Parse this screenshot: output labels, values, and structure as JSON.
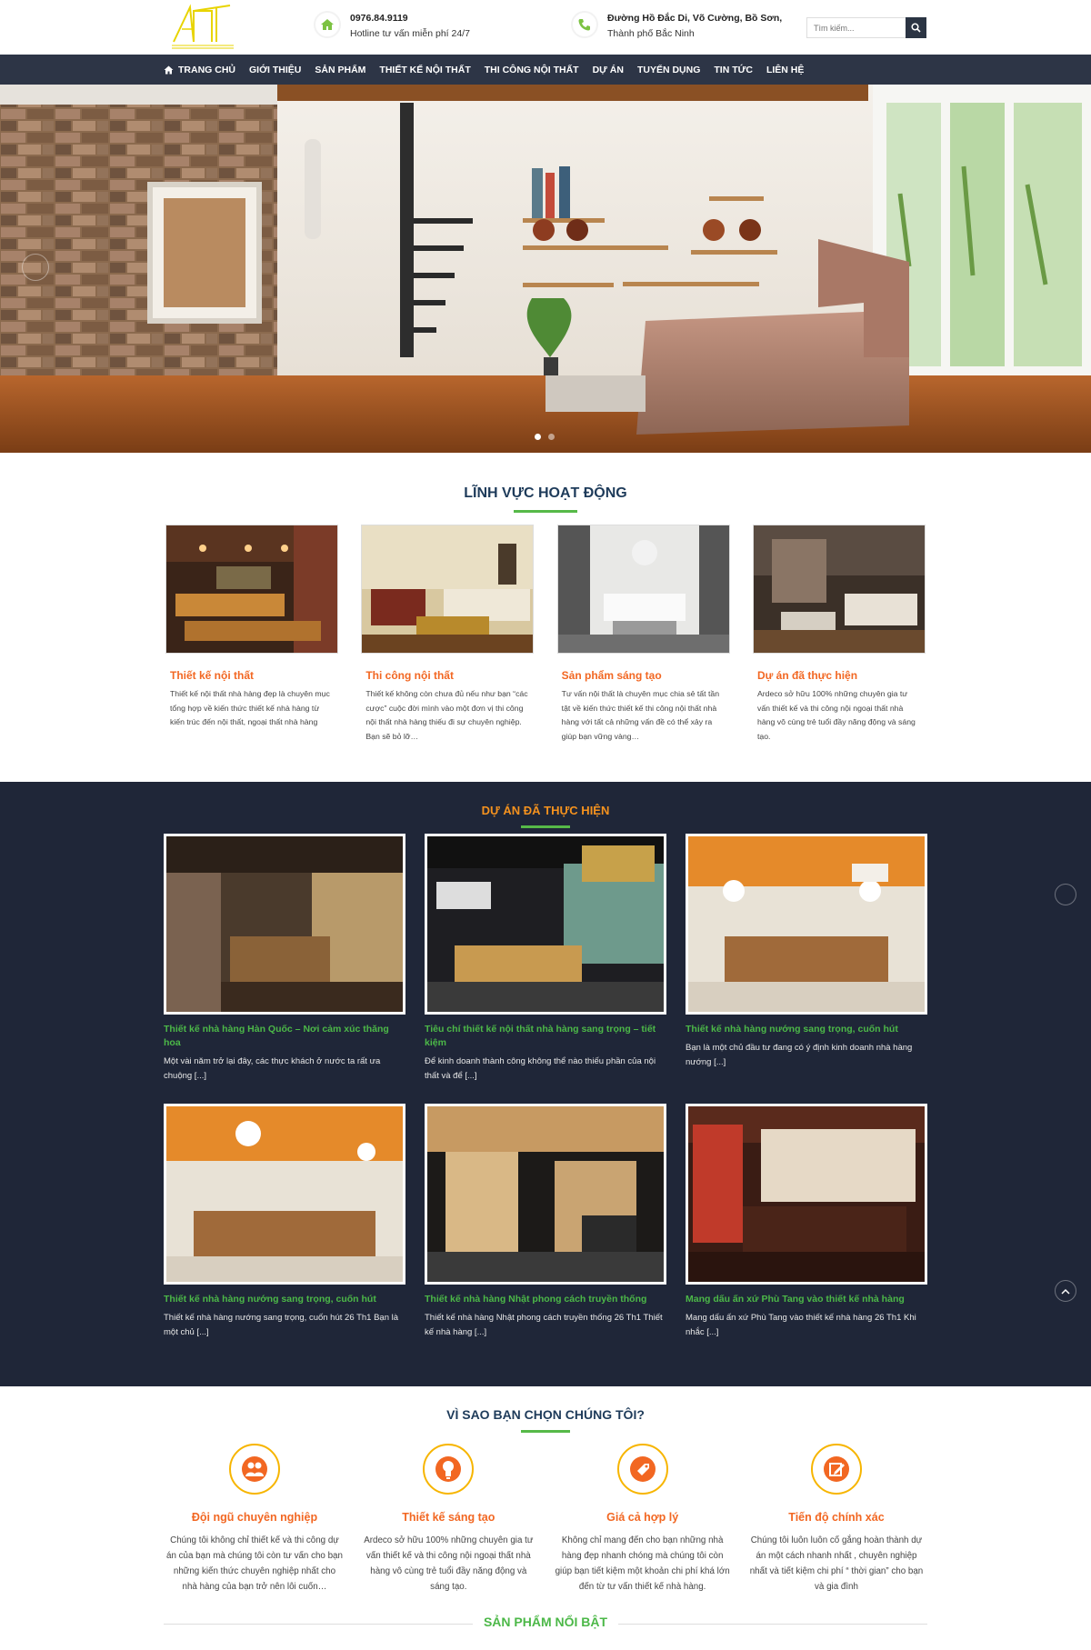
{
  "header": {
    "logo_alt": "AT",
    "phone": "0976.84.9119",
    "hotline": "Hotline tư vấn miễn phí 24/7",
    "address_line1": "Đường Hồ Đắc Di, Võ Cường, Bồ Sơn,",
    "address_line2": "Thành phố Bắc Ninh",
    "search_placeholder": "Tìm kiếm...",
    "phone_icon_color": "#7cc242",
    "address_icon_color": "#7cc242"
  },
  "nav": {
    "items": [
      "TRANG CHỦ",
      "GIỚI THIỆU",
      "SẢN PHẨM",
      "THIẾT KẾ NỘI THẤT",
      "THI CÔNG NỘI THẤT",
      "DỰ ÁN",
      "TUYỂN DỤNG",
      "TIN TỨC",
      "LIÊN HỆ"
    ]
  },
  "hero": {
    "slides": 2,
    "active_slide": 1
  },
  "fields": {
    "title": "LĨNH VỰC HOẠT ĐỘNG",
    "items": [
      {
        "title": "Thiết kế nội thất",
        "text": "Thiết kế nội thất nhà hàng đẹp là chuyên mục tổng hợp về kiến thức thiết kế nhà hàng từ kiến trúc đến nội thất, ngoại thất nhà hàng"
      },
      {
        "title": "Thi công nội thất",
        "text": "Thiết kế không còn chưa đủ nếu như bạn “các cược” cuộc đời mình vào một đơn vị thi công nội thất nhà hàng thiếu đi sự chuyên nghiệp. Bạn sẽ bỏ lỡ…"
      },
      {
        "title": "Sản phẩm sáng tạo",
        "text": "Tư vấn nội thất là chuyên mục chia sẻ tất tần tật về kiến thức thiết kế thi công nội thất nhà hàng với tất cả những vấn đề có thể xảy ra giúp bạn vững vàng…"
      },
      {
        "title": "Dự án đã thực hiện",
        "text": "Ardeco sở hữu 100% những chuyên gia tư vấn thiết kế và thi công nội ngoại thất nhà hàng vô cùng trẻ tuổi đầy năng động và sáng tạo."
      }
    ]
  },
  "projects": {
    "title": "DỰ ÁN ĐÃ THỰC HIỆN",
    "items": [
      {
        "title": "Thiết kế nhà hàng Hàn Quốc – Nơi cảm xúc thăng hoa",
        "text": "Một vài năm trở lại đây, các thực khách ở nước ta rất ưa chuộng [...]"
      },
      {
        "title": "Tiêu chí thiết kế nội thất nhà hàng sang trọng – tiết kiệm",
        "text": "Để kinh doanh thành công không thể nào thiếu phần của nội thất và để [...]"
      },
      {
        "title": "Thiết kế nhà hàng nướng sang trọng, cuốn hút",
        "text": "Bạn là một chủ đầu tư đang có ý định kinh doanh nhà hàng nướng [...]"
      },
      {
        "title": "Thiết kế nhà hàng nướng sang trọng, cuốn hút",
        "text": "Thiết kế nhà hàng nướng sang trọng, cuốn hút 26 Th1 Bạn là một chủ [...]"
      },
      {
        "title": "Thiết kế nhà hàng Nhật phong cách truyền thống",
        "text": "Thiết kế nhà hàng Nhật phong cách truyền thống 26 Th1 Thiết kế nhà hàng [...]"
      },
      {
        "title": "Mang dấu ấn xứ Phù Tang vào thiết kế nhà hàng",
        "text": "Mang dấu ấn xứ Phù Tang vào thiết kế nhà hàng 26 Th1 Khi nhắc [...]"
      }
    ]
  },
  "why": {
    "title": "VÌ SAO BẠN CHỌN CHÚNG TÔI?",
    "items": [
      {
        "title": "Đội ngũ chuyên nghiệp",
        "text": "Chúng tôi không chỉ thiết kế và thi công dự án của bạn mà chúng tôi còn tư vấn cho bạn những kiến thức chuyên nghiệp nhất cho nhà hàng của bạn trở nên lôi cuốn…",
        "icon": "team-icon"
      },
      {
        "title": "Thiết kế sáng tạo",
        "text": "Ardeco sở hữu 100% những chuyên gia tư vấn thiết kế và thi công nội ngoại thất nhà hàng vô cùng trẻ tuổi đầy năng động và sáng tạo.",
        "icon": "idea-icon"
      },
      {
        "title": "Giá cả hợp lý",
        "text": "Không chỉ mang đến cho bạn những nhà hàng đẹp nhanh chóng mà chúng tôi còn giúp bạn tiết kiệm một khoản chi phí khá lớn đến từ tư vấn thiết kế nhà hàng.",
        "icon": "price-tag-icon"
      },
      {
        "title": "Tiến độ chính xác",
        "text": "Chúng tôi luôn luôn cố gắng hoàn thành dự án một cách nhanh nhất , chuyên nghiệp nhất và tiết kiệm chi phí “ thời gian” cho bạn và gia đình",
        "icon": "edit-icon"
      }
    ]
  },
  "featured": {
    "title": "SẢN PHẨM NỔI BẬT"
  },
  "colors": {
    "nav_bg": "#2d3546",
    "projects_bg": "#1f2638",
    "accent_orange": "#f26722",
    "accent_green": "#56b948",
    "icon_ring": "#f7b500"
  }
}
